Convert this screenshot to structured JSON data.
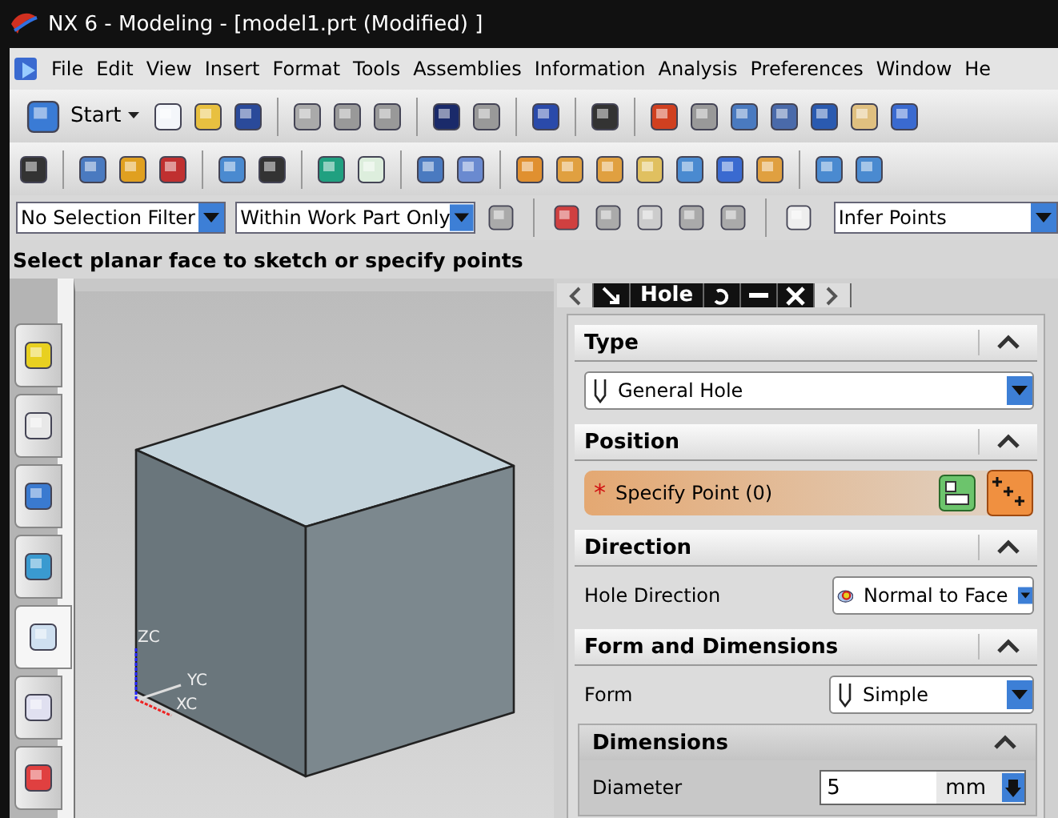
{
  "window": {
    "title": "NX 6 - Modeling - [model1.prt (Modified) ]"
  },
  "menu": [
    "File",
    "Edit",
    "View",
    "Insert",
    "Format",
    "Tools",
    "Assemblies",
    "Information",
    "Analysis",
    "Preferences",
    "Window",
    "He"
  ],
  "toolbar": {
    "start_label": "Start"
  },
  "selection_bar": {
    "type_filter": "No Selection Filter",
    "scope": "Within Work Part Only",
    "snap": "Infer Points"
  },
  "prompt": "Select planar face to sketch or specify points",
  "resource_tabs": [
    {
      "selected": false
    },
    {
      "selected": false
    },
    {
      "selected": false
    },
    {
      "selected": false
    },
    {
      "selected": true
    },
    {
      "selected": false
    },
    {
      "selected": false
    }
  ],
  "viewport": {
    "axes": [
      "ZC",
      "YC",
      "XC"
    ]
  },
  "dialog": {
    "title": "Hole",
    "sections": [
      {
        "kind": "dropdown",
        "title": "Type",
        "expanded": true,
        "value": "General Hole"
      },
      {
        "kind": "point",
        "title": "Position",
        "expanded": true,
        "marker": "*",
        "label": "Specify Point (0)"
      },
      {
        "kind": "labeled",
        "title": "Direction",
        "expanded": true,
        "label": "Hole Direction",
        "value": "Normal to Face"
      },
      {
        "kind": "form",
        "title": "Form and Dimensions",
        "expanded": true,
        "label": "Form",
        "value": "Simple",
        "group": {
          "title": "Dimensions",
          "expanded": true,
          "field_label": "Diameter",
          "field_value": "5",
          "unit": "mm"
        }
      }
    ]
  }
}
